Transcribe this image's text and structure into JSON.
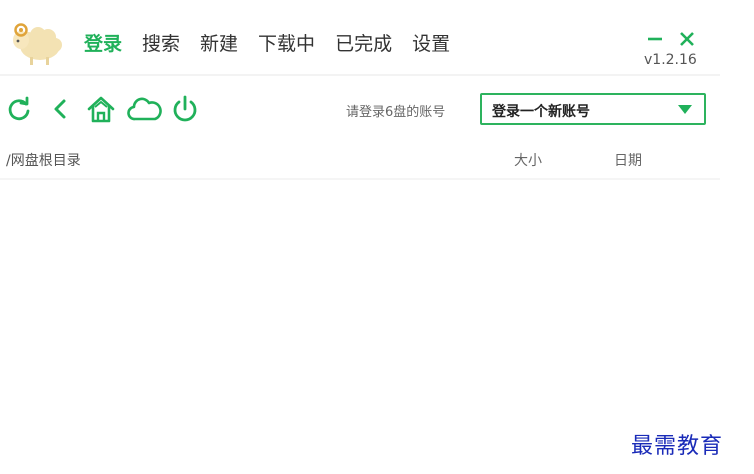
{
  "nav": {
    "tabs": [
      {
        "label": "登录",
        "active": true
      },
      {
        "label": "搜索",
        "active": false
      },
      {
        "label": "新建",
        "active": false
      },
      {
        "label": "下载中",
        "active": false
      },
      {
        "label": "已完成",
        "active": false
      },
      {
        "label": "设置",
        "active": false
      }
    ]
  },
  "window": {
    "version": "v1.2.16",
    "controls": [
      "minimize-icon",
      "close-icon"
    ]
  },
  "toolbar": {
    "icons": [
      "refresh-icon",
      "back-icon",
      "home-icon",
      "cloud-icon",
      "power-icon"
    ],
    "account_hint": "请登录6盘的账号",
    "account_select_value": "登录一个新账号"
  },
  "list": {
    "path": "/网盘根目录",
    "col_size": "大小",
    "col_date": "日期"
  },
  "watermark": "最需教育",
  "colors": {
    "accent": "#20b15a",
    "watermark": "#1a2bb8"
  }
}
